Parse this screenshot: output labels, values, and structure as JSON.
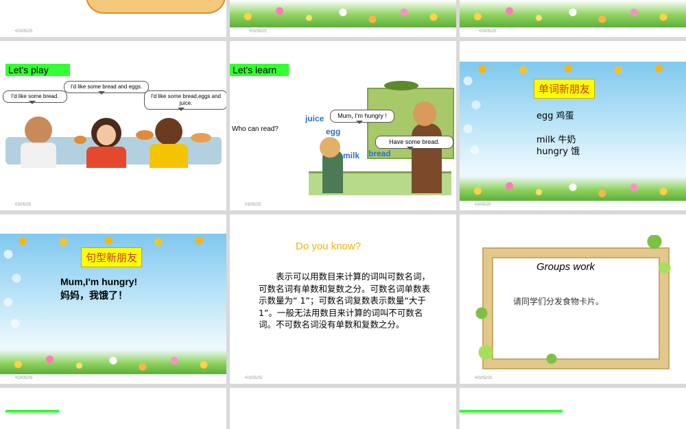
{
  "dates": {
    "top1": "•03/05/25",
    "top2": "•03/05/25",
    "top3": "•03/05/25",
    "mid1": "03/05/25",
    "mid2": "03/05/25",
    "mid3": "03/05/25",
    "low1": "•03/05/25",
    "low2": "•03/05/25",
    "low3": "•03/05/25"
  },
  "slide_play": {
    "title": "Let's play",
    "bubble1": "I'd like some bread.",
    "bubble2": "I'd like some bread and eggs.",
    "bubble3": "I'd like some bread,eggs and juice."
  },
  "slide_learn": {
    "title": "Let's learn",
    "question": "Who can read?",
    "bubble_kid": "Mum, I'm hungry !",
    "bubble_mum": "Have some bread.",
    "words": {
      "juice": "juice",
      "egg": "egg",
      "milk": "milk",
      "bread": "bread"
    }
  },
  "slide_words": {
    "heading": "单词新朋友",
    "lines": [
      "egg 鸡蛋",
      "milk 牛奶",
      "hungry 饿"
    ]
  },
  "slide_sentence": {
    "heading": "句型新朋友",
    "line1": "Mum,I'm hungry!",
    "line2": "妈妈，我饿了！"
  },
  "slide_know": {
    "title": "Do you know?",
    "body": "表示可以用数目来计算的词叫可数名词，可数名词有单数和复数之分。可数名词单数表示数量为“ 1”；可数名词复数表示数量“大于 1”。一般无法用数目来计算的词叫不可数名词。不可数名词没有单数和复数之分。"
  },
  "slide_groups": {
    "title": "Groups work",
    "body": "请同学们分发食物卡片。"
  },
  "colors": {
    "label_green": "#33ff33",
    "heading_yellow": "#ffff00",
    "know_title": "#f0b400",
    "word_blue": "#2a6fc9"
  }
}
